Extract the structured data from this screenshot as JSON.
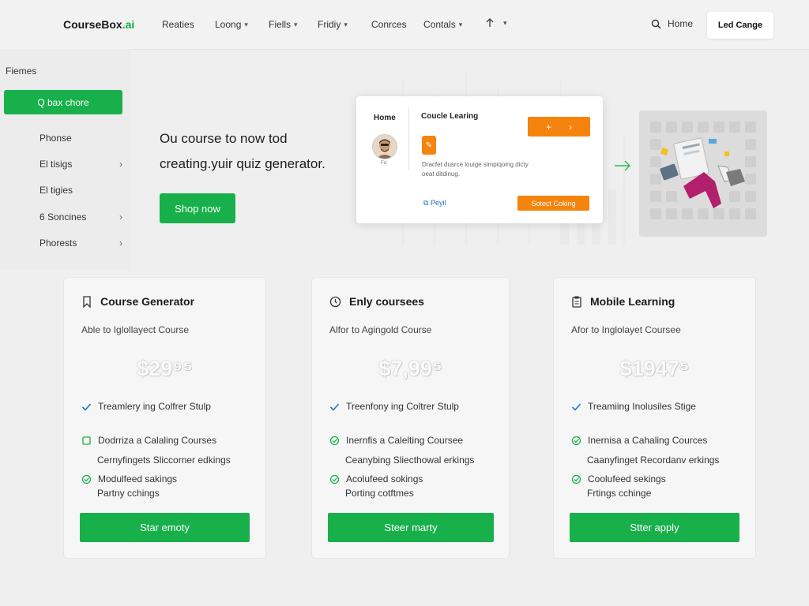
{
  "header": {
    "logo_main": "CourseBox",
    "logo_suffix": ".ai",
    "nav": [
      "Reaties",
      "Loong",
      "Fiells",
      "Fridiy",
      "Conrces",
      "Contals"
    ],
    "search_label": "Home",
    "cta_label": "Led Cange"
  },
  "sidebar": {
    "title": "Fiemes",
    "active_item": "Q bax chore",
    "items": [
      "Phonse",
      "El tisigs",
      "El tigies",
      "6 Soncines",
      "Phorests"
    ]
  },
  "hero": {
    "line1": "Ou course to now tod",
    "line2": "creating.yuir quiz generator.",
    "button_label": "Shop now"
  },
  "preview_card": {
    "home_label": "Home",
    "avatar_label": "Fd",
    "title": "Coucle Learing",
    "button_plus": "+",
    "button_chevron": "›",
    "description_line1": "Dracfet dusrce louige simpiqoing dicty",
    "description_line2": "oeat ditdinug.",
    "link_label": "Peyil",
    "action_label": "Sotect Coking"
  },
  "pricing": [
    {
      "title": "Course Generator",
      "icon": "bookmark-icon",
      "subtitle": "Able to Iglollayect Course",
      "price": "$29⁹⁵",
      "features": [
        {
          "icon": "check-icon",
          "text": "Treamlery ing Colfrer Stulp"
        },
        {
          "icon": "square-icon",
          "text": "Dodrriza a Calaling Courses"
        },
        {
          "icon": "none",
          "text": "Cernyfingets Sliccorner edkings"
        },
        {
          "icon": "check-circle-icon",
          "text": "Modulfeed sakings"
        },
        {
          "icon": "none",
          "text": "Partny cchings"
        }
      ],
      "button_label": "Star emoty"
    },
    {
      "title": "Enly courseеs",
      "icon": "clock-icon",
      "subtitle": "Alfor to Agingold Course",
      "price": "$7,99⁵",
      "features": [
        {
          "icon": "check-icon",
          "text": "Treenfony ing Coltrer Stulp"
        },
        {
          "icon": "check-circle-icon",
          "text": "Inernfis a Calelting Coursee"
        },
        {
          "icon": "none",
          "text": "Ceanybing Sliecthowal erkings"
        },
        {
          "icon": "check-circle-icon",
          "text": "Acolufeed sokings"
        },
        {
          "icon": "none",
          "text": "Porting cotftmes"
        }
      ],
      "button_label": "Steer marty"
    },
    {
      "title": "Mobile Learning",
      "icon": "clipboard-icon",
      "subtitle": "Afor to Inglolayet Coursee",
      "price": "$1947⁵",
      "features": [
        {
          "icon": "check-icon",
          "text": "Treamiing Inolusiles Stige"
        },
        {
          "icon": "check-circle-icon",
          "text": "Inernisa a Cahaling Cources"
        },
        {
          "icon": "none",
          "text": "Caanyfinget Recordanv erkings"
        },
        {
          "icon": "check-circle-icon",
          "text": "Coolufeed sekings"
        },
        {
          "icon": "none",
          "text": "Frtings cchinge"
        }
      ],
      "button_label": "Stter apply"
    }
  ],
  "colors": {
    "accent_green": "#18b04a",
    "accent_orange": "#f4840e",
    "link_blue": "#1d6fc8",
    "check_blue": "#1f77c9",
    "background": "#efefef"
  }
}
